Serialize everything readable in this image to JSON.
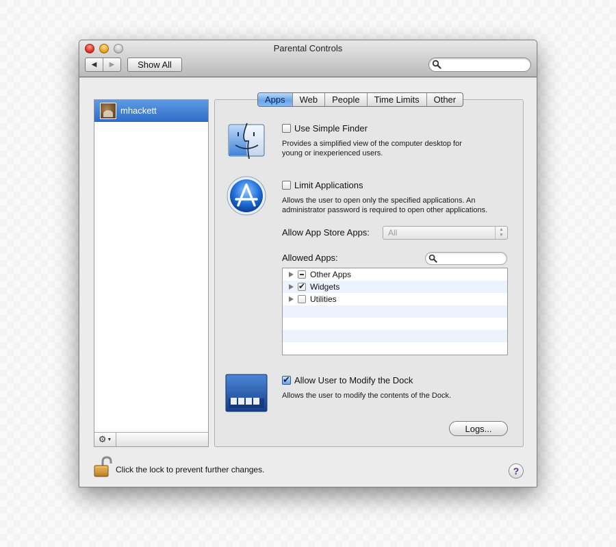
{
  "window": {
    "title": "Parental Controls"
  },
  "toolbar": {
    "back_glyph": "◀",
    "forward_glyph": "▶",
    "show_all_label": "Show All",
    "search_placeholder": "",
    "search_value": ""
  },
  "sidebar": {
    "users": [
      {
        "name": "mhackett",
        "selected": true
      }
    ],
    "gear_icon": "gear-icon",
    "gear_glyph": "⚙"
  },
  "tabs": [
    {
      "label": "Apps",
      "active": true
    },
    {
      "label": "Web",
      "active": false
    },
    {
      "label": "People",
      "active": false
    },
    {
      "label": "Time Limits",
      "active": false
    },
    {
      "label": "Other",
      "active": false
    }
  ],
  "apps_panel": {
    "simple_finder": {
      "label": "Use Simple Finder",
      "checked": false,
      "description_line1": "Provides a simplified view of the computer desktop for",
      "description_line2": "young or inexperienced users.",
      "icon": "finder-icon"
    },
    "limit_apps": {
      "label": "Limit Applications",
      "checked": false,
      "description_line1": "Allows the user to open only the specified applications. An",
      "description_line2": "administrator password is required to open other applications.",
      "icon": "app-store-icon"
    },
    "app_store": {
      "label": "Allow App Store Apps:",
      "selected": "All",
      "enabled": false
    },
    "allowed_apps": {
      "label": "Allowed Apps:",
      "search_placeholder": "",
      "items": [
        {
          "label": "Other Apps",
          "state": "mixed"
        },
        {
          "label": "Widgets",
          "state": "checked"
        },
        {
          "label": "Utilities",
          "state": "unchecked"
        }
      ]
    },
    "dock": {
      "label": "Allow User to Modify the Dock",
      "checked": true,
      "description": "Allows the user to modify the contents of the Dock.",
      "icon": "dock-icon"
    },
    "logs_label": "Logs..."
  },
  "footer": {
    "lock_text": "Click the lock to prevent further changes.",
    "lock_icon": "unlocked-padlock-icon",
    "help_glyph": "?"
  },
  "colors": {
    "selection_blue": "#2f6ec9",
    "tab_active": "#6aa5ea",
    "close": "#e2352a",
    "minimize": "#f2a526",
    "zoom": "#c9c9c9",
    "list_stripe": "#edf3fe"
  }
}
